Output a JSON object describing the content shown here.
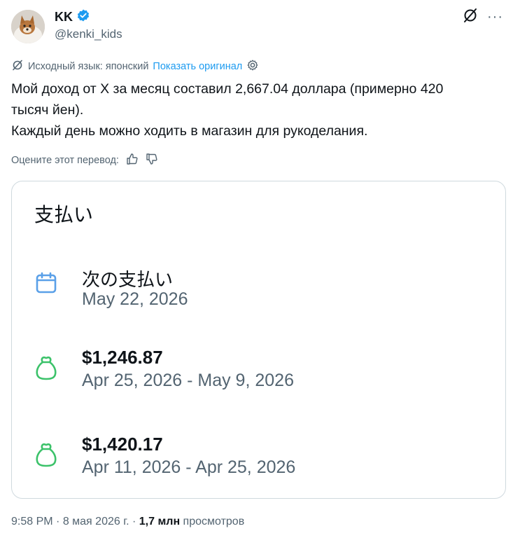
{
  "author": {
    "name": "KK",
    "handle": "@kenki_kids"
  },
  "translation": {
    "source_label": "Исходный язык: японский",
    "show_original": "Показать оригинал"
  },
  "tweet": {
    "line1": "Мой доход от X за месяц составил 2,667.04 доллара (примерно 420",
    "line2": "тысяч йен).",
    "line3": "Каждый день можно ходить в магазин для рукоделания."
  },
  "rate": {
    "label": "Оцените этот перевод:"
  },
  "card": {
    "title": "支払い",
    "items": [
      {
        "icon": "calendar-icon",
        "title": "次の支払い",
        "subtitle": "May 22, 2026"
      },
      {
        "icon": "money-bag-icon",
        "title": "$1,246.87",
        "subtitle": "Apr 25, 2026 - May 9, 2026"
      },
      {
        "icon": "money-bag-icon",
        "title": "$1,420.17",
        "subtitle": "Apr 11, 2026 - Apr 25, 2026"
      }
    ]
  },
  "footer": {
    "time": "9:58 PM",
    "sep1": " · ",
    "date": "8 мая 2026 г.",
    "sep2": " · ",
    "views": "1,7 млн",
    "views_label": " просмотров"
  },
  "colors": {
    "accent": "#1d9bf0",
    "calendar": "#5aa0e8",
    "money": "#3cc26a",
    "secondary_text": "#536471"
  }
}
